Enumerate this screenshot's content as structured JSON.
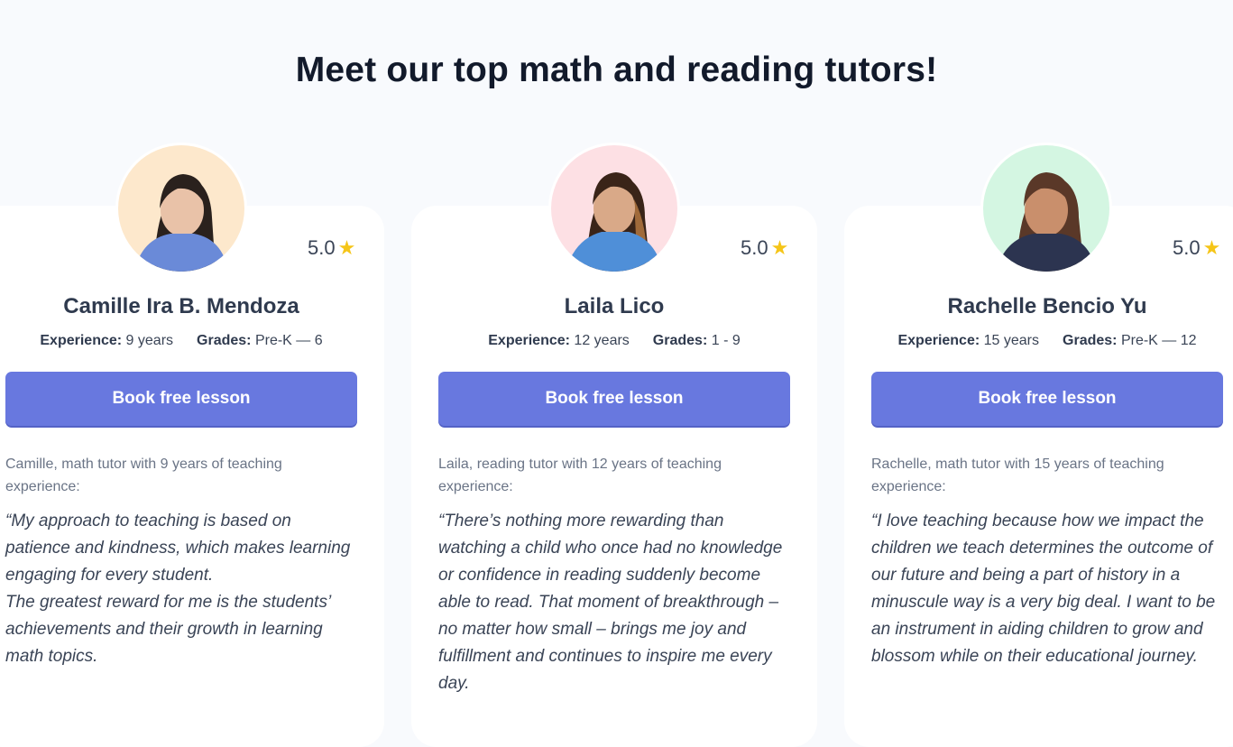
{
  "page": {
    "title": "Meet our top math and reading tutors!"
  },
  "tutors": [
    {
      "name": "Camille Ira B. Mendoza",
      "rating": "5.0",
      "experience_label": "Experience:",
      "experience_value": "9 years",
      "grades_label": "Grades:",
      "grades_value": "Pre-K — 6",
      "button_label": "Book free lesson",
      "intro": "Camille, math tutor with 9 years of teaching experience:",
      "quote": "“My approach to teaching is based on patience and kindness, which makes learning engaging for every student.\nThe greatest reward for me is the students’ achievements and their growth in learning math topics.",
      "avatar_bg": "#fde8cc",
      "shirt_color": "#6a8ad8"
    },
    {
      "name": "Laila Lico",
      "rating": "5.0",
      "experience_label": "Experience:",
      "experience_value": "12 years",
      "grades_label": "Grades:",
      "grades_value": "1 - 9",
      "button_label": "Book free lesson",
      "intro": "Laila, reading tutor with 12 years of teaching experience:",
      "quote": "“There’s nothing more rewarding than watching a child who once had no knowledge or confidence in reading suddenly become able to read. That moment of breakthrough – no matter how small – brings me joy and fulfillment and continues to inspire me every day.",
      "avatar_bg": "#fde0e4",
      "shirt_color": "#4f8fd8"
    },
    {
      "name": "Rachelle Bencio Yu",
      "rating": "5.0",
      "experience_label": "Experience:",
      "experience_value": "15 years",
      "grades_label": "Grades:",
      "grades_value": "Pre-K — 12",
      "button_label": "Book free lesson",
      "intro": "Rachelle, math tutor with 15 years of teaching experience:",
      "quote": "“I love teaching because how we impact the children we teach determines the outcome of our future and being a part of history in a minuscule way is a very big deal. I want to be an instrument in aiding children to grow and blossom while on their educational journey.",
      "avatar_bg": "#d4f6e2",
      "shirt_color": "#2c3450"
    }
  ],
  "icons": {
    "rating": "star-icon"
  },
  "colors": {
    "accent": "#6878df",
    "star": "#f5c518",
    "background": "#f8fafd"
  }
}
